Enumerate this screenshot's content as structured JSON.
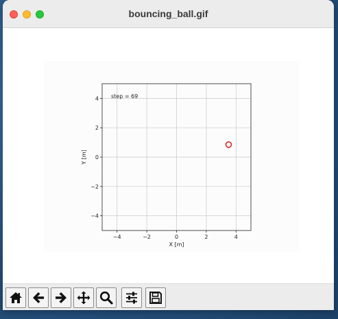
{
  "window": {
    "title": "bouncing_ball.gif"
  },
  "plot": {
    "annotation": "step = 69",
    "xlabel": "X [m]",
    "ylabel": "Y [m]",
    "xlim": [
      -5,
      5
    ],
    "ylim": [
      -5,
      5
    ],
    "grid": true,
    "xticks": [
      -4,
      -2,
      0,
      2,
      4
    ],
    "yticks": [
      -4,
      -2,
      0,
      2,
      4
    ],
    "xtick_labels": [
      "−4",
      "−2",
      "0",
      "2",
      "4"
    ],
    "ytick_labels": [
      "−4",
      "−2",
      "0",
      "2",
      "4"
    ],
    "ball": {
      "x": 3.5,
      "y": 0.85,
      "edge_color": "#d62728"
    }
  },
  "toolbar": {
    "buttons": [
      {
        "name": "home-button",
        "icon": "home-icon"
      },
      {
        "name": "back-button",
        "icon": "arrow-left-icon"
      },
      {
        "name": "forward-button",
        "icon": "arrow-right-icon"
      },
      {
        "name": "pan-button",
        "icon": "move-icon"
      },
      {
        "name": "zoom-button",
        "icon": "zoom-icon"
      },
      {
        "name": "configure-subplots-button",
        "icon": "sliders-icon"
      },
      {
        "name": "save-button",
        "icon": "save-icon"
      }
    ]
  }
}
